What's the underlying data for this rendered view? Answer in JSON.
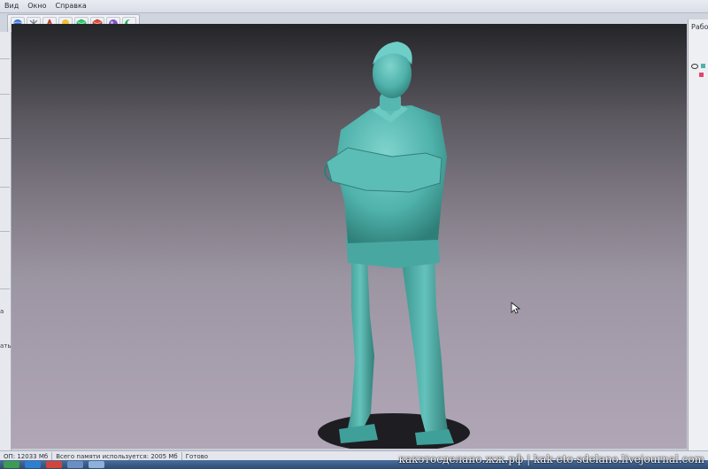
{
  "menu": {
    "items": [
      "Вид",
      "Окно",
      "Справка"
    ]
  },
  "toolbar": {
    "buttons": [
      {
        "name": "sphere-view-icon",
        "color": "#3b6fcf"
      },
      {
        "name": "axes-icon",
        "color": "#7a7f8a"
      },
      {
        "name": "tripod-icon",
        "color": "#c0392b"
      },
      {
        "name": "lightbulb-icon",
        "color": "#f2c12e"
      },
      {
        "name": "cube-green-icon",
        "color": "#2ecc71"
      },
      {
        "name": "cube-red-icon",
        "color": "#e74c3c"
      },
      {
        "name": "sphere-purple-icon",
        "color": "#7e57c2"
      },
      {
        "name": "moon-icon",
        "color": "#27ae60"
      }
    ]
  },
  "left_panel": {
    "fragments": [
      "а",
      "ать"
    ]
  },
  "right_panel": {
    "title": "Рабо"
  },
  "viewport": {
    "model_color": "#4fb2ab",
    "cursor_icon": "arrow-cursor-icon"
  },
  "status": {
    "ram": "ОП: 12033 Мб",
    "memory_used": "Всего памяти используется: 2005 Мб",
    "state": "Готово"
  },
  "watermark": {
    "text": "какэтосделано.жж.рф | kak-eto-sdelano.livejournal.com"
  }
}
